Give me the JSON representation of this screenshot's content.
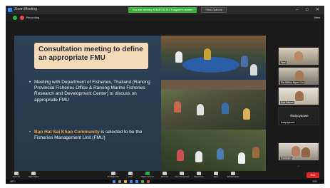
{
  "window": {
    "title": "Zoom Meeting",
    "share_banner": "You are viewing KRAPOS-TH Thagobe's screen",
    "view_options": "View Options",
    "controls": [
      "–",
      "□",
      "✕"
    ]
  },
  "subbar": {
    "recording": "Recording",
    "view": "View"
  },
  "slide": {
    "title": "Consultation meeting to define an appropriate FMU",
    "bullet1": "Meeting with Department of Fisheries, Thailand (Ranong Provincial Fisheries Office & Ranong Marine Fisheries Research and Development Center) to discuss on appropriate FMU",
    "bullet2_highlight": "Ban Hat Sai Khao Community",
    "bullet2_rest": " is selected to be the Fisheries Management Unit (FMU)"
  },
  "participants": [
    {
      "name": "Wan"
    },
    {
      "name": "Pol Wilbur Biyan Col"
    },
    {
      "name": "Kiat Salcon"
    },
    {
      "name": "thatyoyaowe",
      "label": "thatyoyaowe"
    },
    {
      "name": "Sontaiper"
    }
  ],
  "toolbar": {
    "items": [
      {
        "label": "Unmute",
        "icon": "mic-icon"
      },
      {
        "label": "Start Video",
        "icon": "camera-icon"
      },
      {
        "label": "Participants",
        "icon": "people-icon"
      },
      {
        "label": "Chat",
        "icon": "chat-icon"
      },
      {
        "label": "Share Screen",
        "icon": "share-icon"
      },
      {
        "label": "Record",
        "icon": "record-icon"
      },
      {
        "label": "Live Transcript",
        "icon": "cc-icon"
      },
      {
        "label": "Reactions",
        "icon": "emoji-icon"
      },
      {
        "label": "Apps",
        "icon": "apps-icon"
      },
      {
        "label": "Whiteboards",
        "icon": "whiteboard-icon"
      }
    ],
    "end": "End"
  },
  "taskbar": {
    "weather": "28°C",
    "time": "3:01"
  },
  "colors": {
    "share_green": "#3fae3f",
    "highlight": "#f3a437",
    "end_red": "#e02828"
  }
}
